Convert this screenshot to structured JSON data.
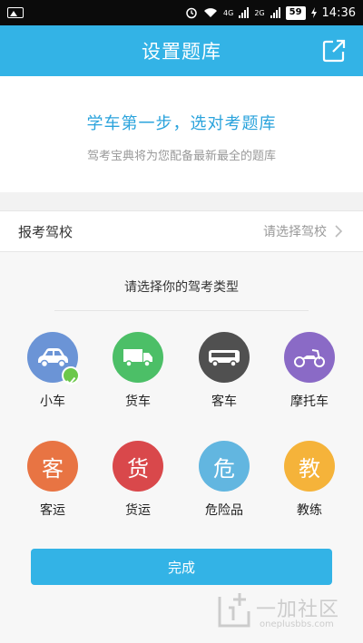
{
  "status_bar": {
    "network_4g": "4G",
    "network_2g": "2G",
    "battery": "59",
    "time": "14:36"
  },
  "header": {
    "title": "设置题库",
    "share_icon": "share-out-icon"
  },
  "intro": {
    "title": "学车第一步，选对考题库",
    "subtitle": "驾考宝典将为您配备最新最全的题库"
  },
  "school": {
    "label": "报考驾校",
    "placeholder": "请选择驾校"
  },
  "types_section": {
    "title": "请选择你的驾考类型",
    "items": [
      {
        "label": "小车",
        "icon": "car-icon",
        "color": "#6b94d6",
        "selected": true
      },
      {
        "label": "货车",
        "icon": "truck-icon",
        "color": "#4cbf67",
        "selected": false
      },
      {
        "label": "客车",
        "icon": "bus-icon",
        "color": "#505050",
        "selected": false
      },
      {
        "label": "摩托车",
        "icon": "motorcycle-icon",
        "color": "#8a6ac6",
        "selected": false
      },
      {
        "label": "客运",
        "glyph": "客",
        "color": "#e87443",
        "selected": false
      },
      {
        "label": "货运",
        "glyph": "货",
        "color": "#d9484b",
        "selected": false
      },
      {
        "label": "危险品",
        "glyph": "危",
        "color": "#62b6e0",
        "selected": false
      },
      {
        "label": "教练",
        "glyph": "教",
        "color": "#f5b33a",
        "selected": false
      }
    ]
  },
  "done_button": {
    "label": "完成"
  },
  "watermark": {
    "text": "一加社区",
    "url": "oneplusbbs.com"
  }
}
